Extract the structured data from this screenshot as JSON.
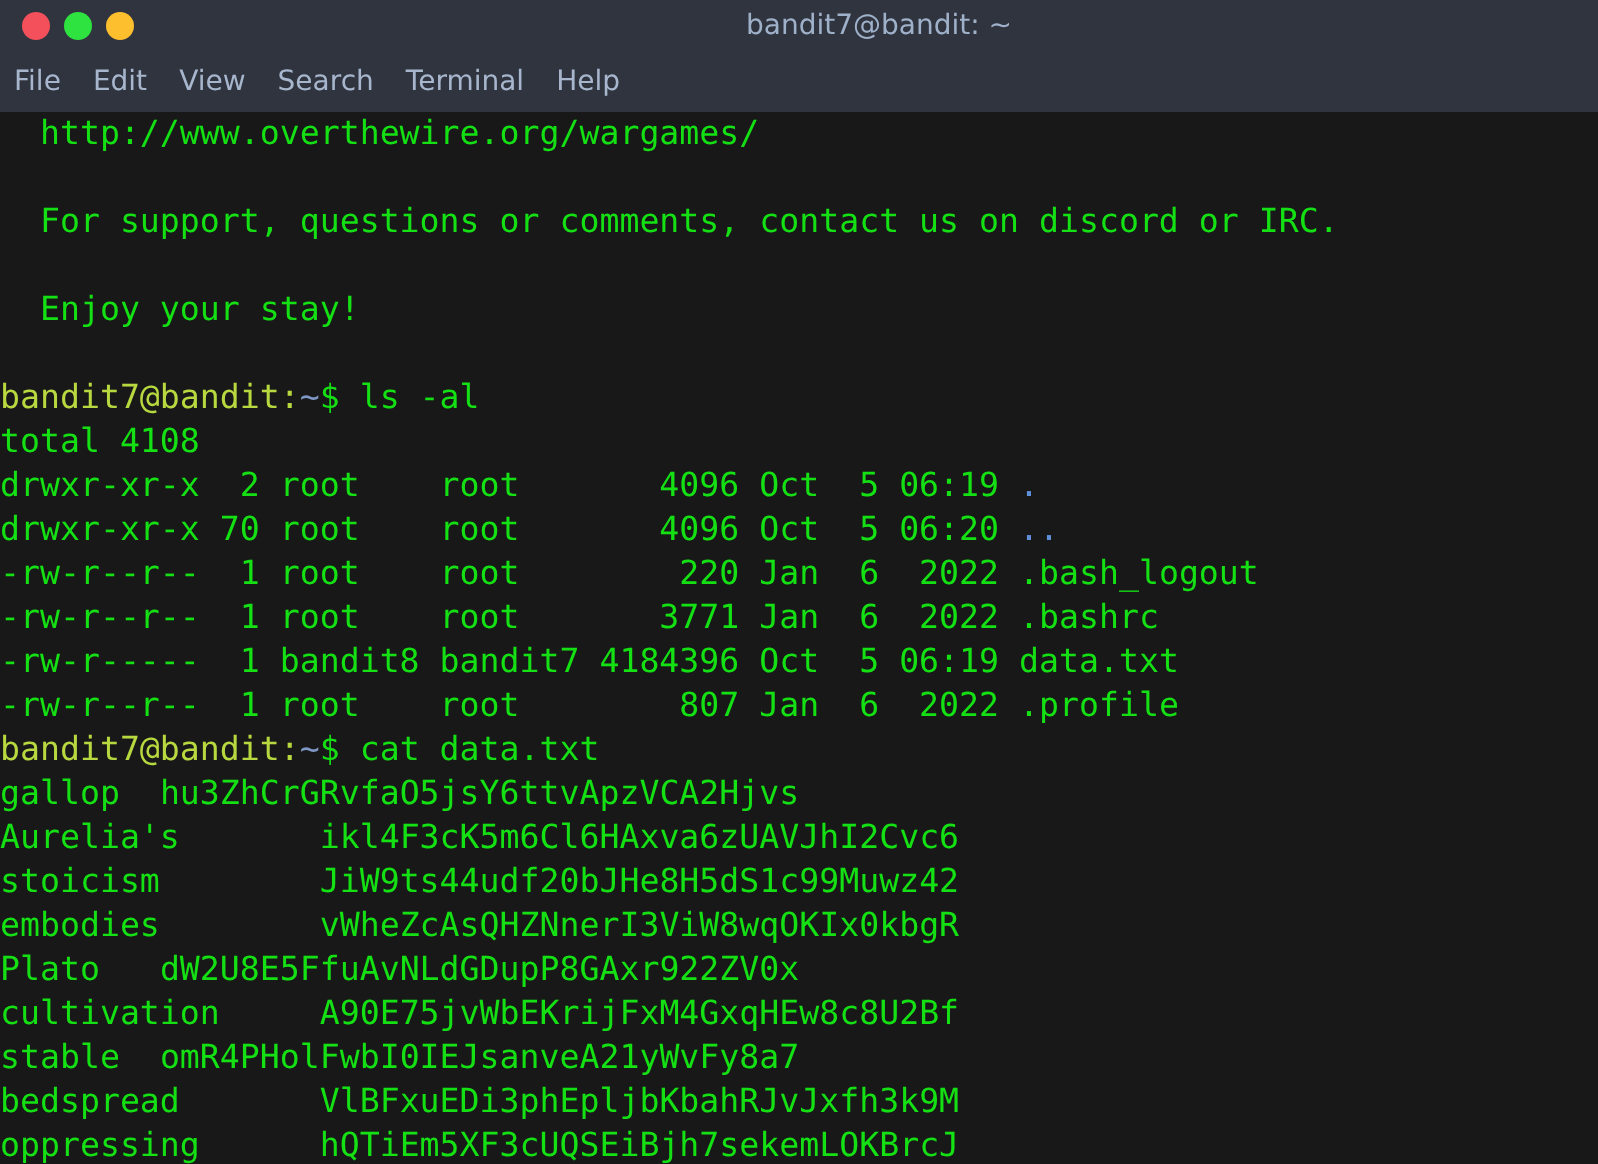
{
  "window": {
    "title": "bandit7@bandit: ~"
  },
  "menu": [
    "File",
    "Edit",
    "View",
    "Search",
    "Terminal",
    "Help"
  ],
  "terminal": {
    "lines": [
      {
        "kind": "text",
        "text": "  http://www.overthewire.org/wargames/"
      },
      {
        "kind": "blank"
      },
      {
        "kind": "text",
        "text": "  For support, questions or comments, contact us on discord or IRC."
      },
      {
        "kind": "blank"
      },
      {
        "kind": "text",
        "text": "  Enjoy your stay!"
      },
      {
        "kind": "blank"
      },
      {
        "kind": "prompt",
        "user": "bandit7@bandit:",
        "path": "~",
        "command": "$ ls -al"
      },
      {
        "kind": "text",
        "text": "total 4108"
      },
      {
        "kind": "listing",
        "meta": "drwxr-xr-x  2 root    root       4096 Oct  5 06:19",
        "name": ".",
        "directory": true
      },
      {
        "kind": "listing",
        "meta": "drwxr-xr-x 70 root    root       4096 Oct  5 06:20",
        "name": "..",
        "directory": true
      },
      {
        "kind": "listing",
        "meta": "-rw-r--r--  1 root    root        220 Jan  6  2022",
        "name": ".bash_logout",
        "directory": false
      },
      {
        "kind": "listing",
        "meta": "-rw-r--r--  1 root    root       3771 Jan  6  2022",
        "name": ".bashrc",
        "directory": false
      },
      {
        "kind": "listing",
        "meta": "-rw-r-----  1 bandit8 bandit7 4184396 Oct  5 06:19",
        "name": "data.txt",
        "directory": false
      },
      {
        "kind": "listing",
        "meta": "-rw-r--r--  1 root    root        807 Jan  6  2022",
        "name": ".profile",
        "directory": false
      },
      {
        "kind": "prompt",
        "user": "bandit7@bandit:",
        "path": "~",
        "command": "$ cat data.txt"
      },
      {
        "kind": "text",
        "text": "gallop\thu3ZhCrGRvfaO5jsY6ttvApzVCA2Hjvs"
      },
      {
        "kind": "text",
        "text": "Aurelia's\tikl4F3cK5m6Cl6HAxva6zUAVJhI2Cvc6"
      },
      {
        "kind": "text",
        "text": "stoicism\tJiW9ts44udf20bJHe8H5dS1c99Muwz42"
      },
      {
        "kind": "text",
        "text": "embodies\tvWheZcAsQHZNnerI3ViW8wqOKIx0kbgR"
      },
      {
        "kind": "text",
        "text": "Plato\tdW2U8E5FfuAvNLdGDupP8GAxr922ZV0x"
      },
      {
        "kind": "text",
        "text": "cultivation\tA90E75jvWbEKrijFxM4GxqHEw8c8U2Bf"
      },
      {
        "kind": "text",
        "text": "stable\tomR4PHolFwbI0IEJsanveA21yWvFy8a7"
      },
      {
        "kind": "text",
        "text": "bedspread\tVlBFxuEDi3phEpljbKbahRJvJxfh3k9M"
      },
      {
        "kind": "text",
        "text": "oppressing\thQTiEm5XF3cUQSEiBjh7sekemLOKBrcJ"
      }
    ]
  }
}
